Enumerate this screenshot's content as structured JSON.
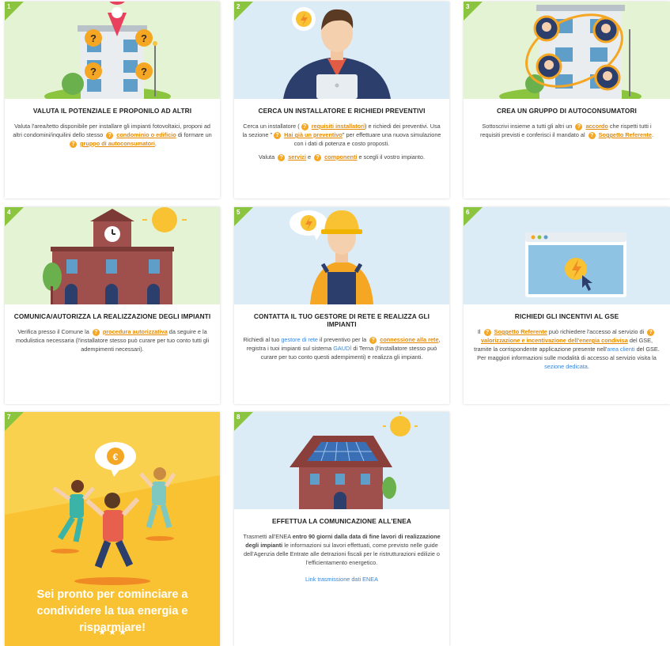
{
  "cards": [
    {
      "number": "1",
      "title": "VALUTA IL POTENZIALE E PROPONILO AD ALTRI",
      "t1": "Valuta l'area/tetto disponibile per installare gli impianti fotovoltaici, proponi ad altri condomini/inquilini dello stesso",
      "l1": "condominio o edificio",
      "t2": "di formare un",
      "l2": "gruppo di autoconsumatori",
      "t3": "."
    },
    {
      "number": "2",
      "title": "CERCA UN INSTALLATORE E RICHIEDI PREVENTIVI",
      "t1": "Cerca un installatore (",
      "l1": "requisiti installatori",
      "t2": ") e richiedi dei preventivi. Usa la sezione \"",
      "l2": "Hai già un preventivo",
      "t3": "\" per effettuare una nuova simulazione con i dati di potenza e costo proposti.",
      "p2_t1": "Valuta",
      "p2_l1": "servizi",
      "p2_t2": "e",
      "p2_l2": "componenti",
      "p2_t3": "e scegli il vostro impianto."
    },
    {
      "number": "3",
      "title": "CREA UN GRUPPO DI AUTOCONSUMATORI",
      "t1": "Sottoscrivi insieme a tutti gli altri un",
      "l1": "accordo",
      "t2": "che rispetti tutti i requisiti previsti e conferisci il mandato al",
      "l2": "Soggetto Referente",
      "t3": "."
    },
    {
      "number": "4",
      "title": "COMUNICA/AUTORIZZA LA REALIZZAZIONE DEGLI IMPIANTI",
      "t1": "Verifica presso il Comune la",
      "l1": "procedura autorizzativa",
      "t2": "da seguire e la modulistica necessaria (l'installatore stesso può curare per tuo conto tutti gli adempimenti necessari)."
    },
    {
      "number": "5",
      "title": "CONTATTA IL TUO GESTORE DI RETE E REALIZZA GLI IMPIANTI",
      "t1": "Richiedi al tuo",
      "b1": "gestore di rete",
      "t2": "il preventivo per la",
      "l1": "connessione alla rete",
      "t3": ", registra i tuoi impianti sul sistema",
      "b2": "GAUDÌ",
      "t4": "di Terna (l'installatore stesso può curare per tuo conto questi adempimenti) e realizza gli impianti."
    },
    {
      "number": "6",
      "title": "RICHIEDI GLI INCENTIVI AL GSE",
      "t1": "Il",
      "l1": "Soggetto Referente",
      "t2": "può richiedere l'accesso al servizio di",
      "l2": "valorizzazione e incentivazione dell'energia condivisa",
      "t3": "del GSE, tramite la corrispondente applicazione presente nell'",
      "b1": "area clienti",
      "t4": "del GSE. Per maggiori informazioni sulle modalità di accesso al servizio visita la",
      "b2": "sezione dedicata",
      "t5": "."
    },
    {
      "number": "7",
      "title": "Sei pronto per cominciare a condividere la tua energia e risparmiare!",
      "stars": "★ ★ ★"
    },
    {
      "number": "8",
      "title": "EFFETTUA LA COMUNICAZIONE ALL'ENEA",
      "t1": "Trasmetti all'ENEA",
      "s1": "entro 90 giorni dalla data di fine lavori di realizzazione degli impianti",
      "t2": "le informazioni sui lavori effettuati, come previsto nelle guide dell'Agenzia delle Entrate alle detrazioni fiscali per le ristrutturazioni edilizie o l'efficientamento energetico.",
      "link": "Link trasmissione dati ENEA"
    }
  ],
  "q_icon": "?",
  "colors": {
    "accent": "#f5a623",
    "link": "#e58a00",
    "green": "#8bc53f",
    "blue_link": "#3a86d8",
    "yellow_card": "#f9c233"
  }
}
